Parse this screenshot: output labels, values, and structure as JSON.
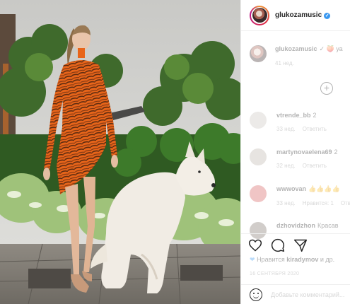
{
  "post": {
    "author": "glukozamusic",
    "verified_mark": "✓"
  },
  "caption": {
    "author": "glukozamusic",
    "text": "✓ 🍑 уа",
    "time": "41 нед."
  },
  "comments": [
    {
      "user": "vtrende_bb",
      "text": "2",
      "time": "33 нед.",
      "reply": "Ответить",
      "extra": ""
    },
    {
      "user": "martynovaelena69",
      "text": "2",
      "time": "32 нед.",
      "reply": "Ответить",
      "extra": ""
    },
    {
      "user": "wwwovan",
      "text": "👍👍👍👍",
      "time": "33 нед.",
      "reply": "Ответить",
      "extra": "Нравится: 1"
    },
    {
      "user": "dzhovidzhon",
      "text": "Красав",
      "time": "",
      "reply": "",
      "extra": ""
    }
  ],
  "likes": {
    "prefix": "Нравится",
    "user": "kiradymov",
    "suffix": "и др."
  },
  "date": "16 сентября 2020",
  "add_comment_placeholder": "Добавьте комментарий...",
  "icons": {
    "like": "heart-icon",
    "comment": "comment-icon",
    "share": "share-icon",
    "more": "plus-circle-icon",
    "emoji": "emoji-icon"
  },
  "colors": {
    "verified": "#3897f0",
    "dress": "#e8651a",
    "dog": "#f1ece4"
  }
}
